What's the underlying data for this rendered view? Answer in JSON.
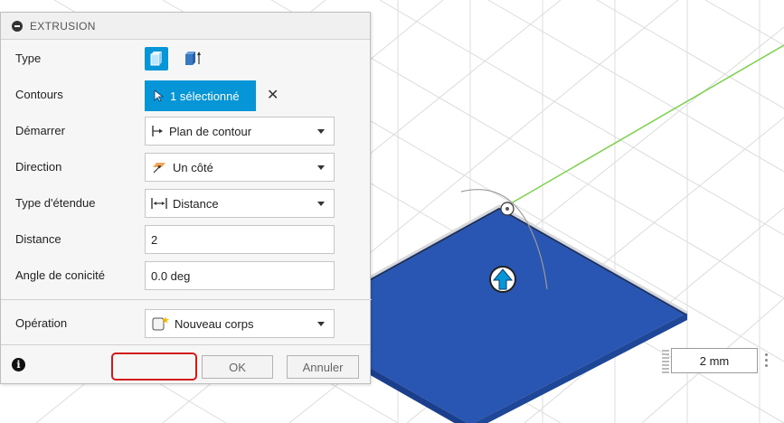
{
  "panel": {
    "title": "EXTRUSION",
    "fields": {
      "type": {
        "label": "Type"
      },
      "contours": {
        "label": "Contours",
        "selection": "1 sélectionné"
      },
      "start": {
        "label": "Démarrer",
        "value": "Plan de contour"
      },
      "direction": {
        "label": "Direction",
        "value": "Un côté"
      },
      "extent_type": {
        "label": "Type d'étendue",
        "value": "Distance"
      },
      "distance": {
        "label": "Distance",
        "value": "2"
      },
      "taper_angle": {
        "label": "Angle de conicité",
        "value": "0.0 deg"
      },
      "operation": {
        "label": "Opération",
        "value": "Nouveau corps"
      }
    },
    "footer": {
      "ok_label": "OK",
      "cancel_label": "Annuler",
      "info_glyph": "i"
    }
  },
  "viewport": {
    "dimension_input": "2 mm",
    "colors": {
      "body": "#2a56b3",
      "grid": "#d8d8d8",
      "axis": "#7bd24a",
      "accent": "#0696d7",
      "highlight": "#d11a1a"
    },
    "icons": [
      "extrude-arrow-icon",
      "rotate-handle-icon",
      "grip-icon",
      "more-menu-icon"
    ]
  }
}
